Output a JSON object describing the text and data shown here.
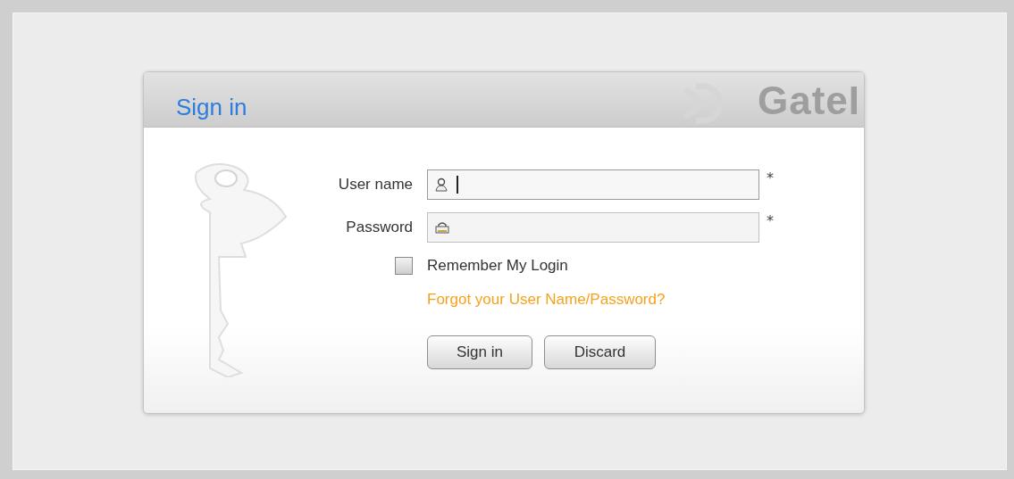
{
  "dialog": {
    "title": "Sign in",
    "logo": "GateI"
  },
  "fields": [
    {
      "label": "User name",
      "kind": "user",
      "required": true,
      "marker": "*",
      "focused": true
    },
    {
      "label": "Password",
      "kind": "password",
      "required": true,
      "marker": "*",
      "focused": false
    }
  ],
  "remember": {
    "label": "Remember My Login",
    "checked": false
  },
  "forgot_link": "Forgot your User Name/Password?",
  "buttons": [
    "Sign in",
    "Discard"
  ]
}
